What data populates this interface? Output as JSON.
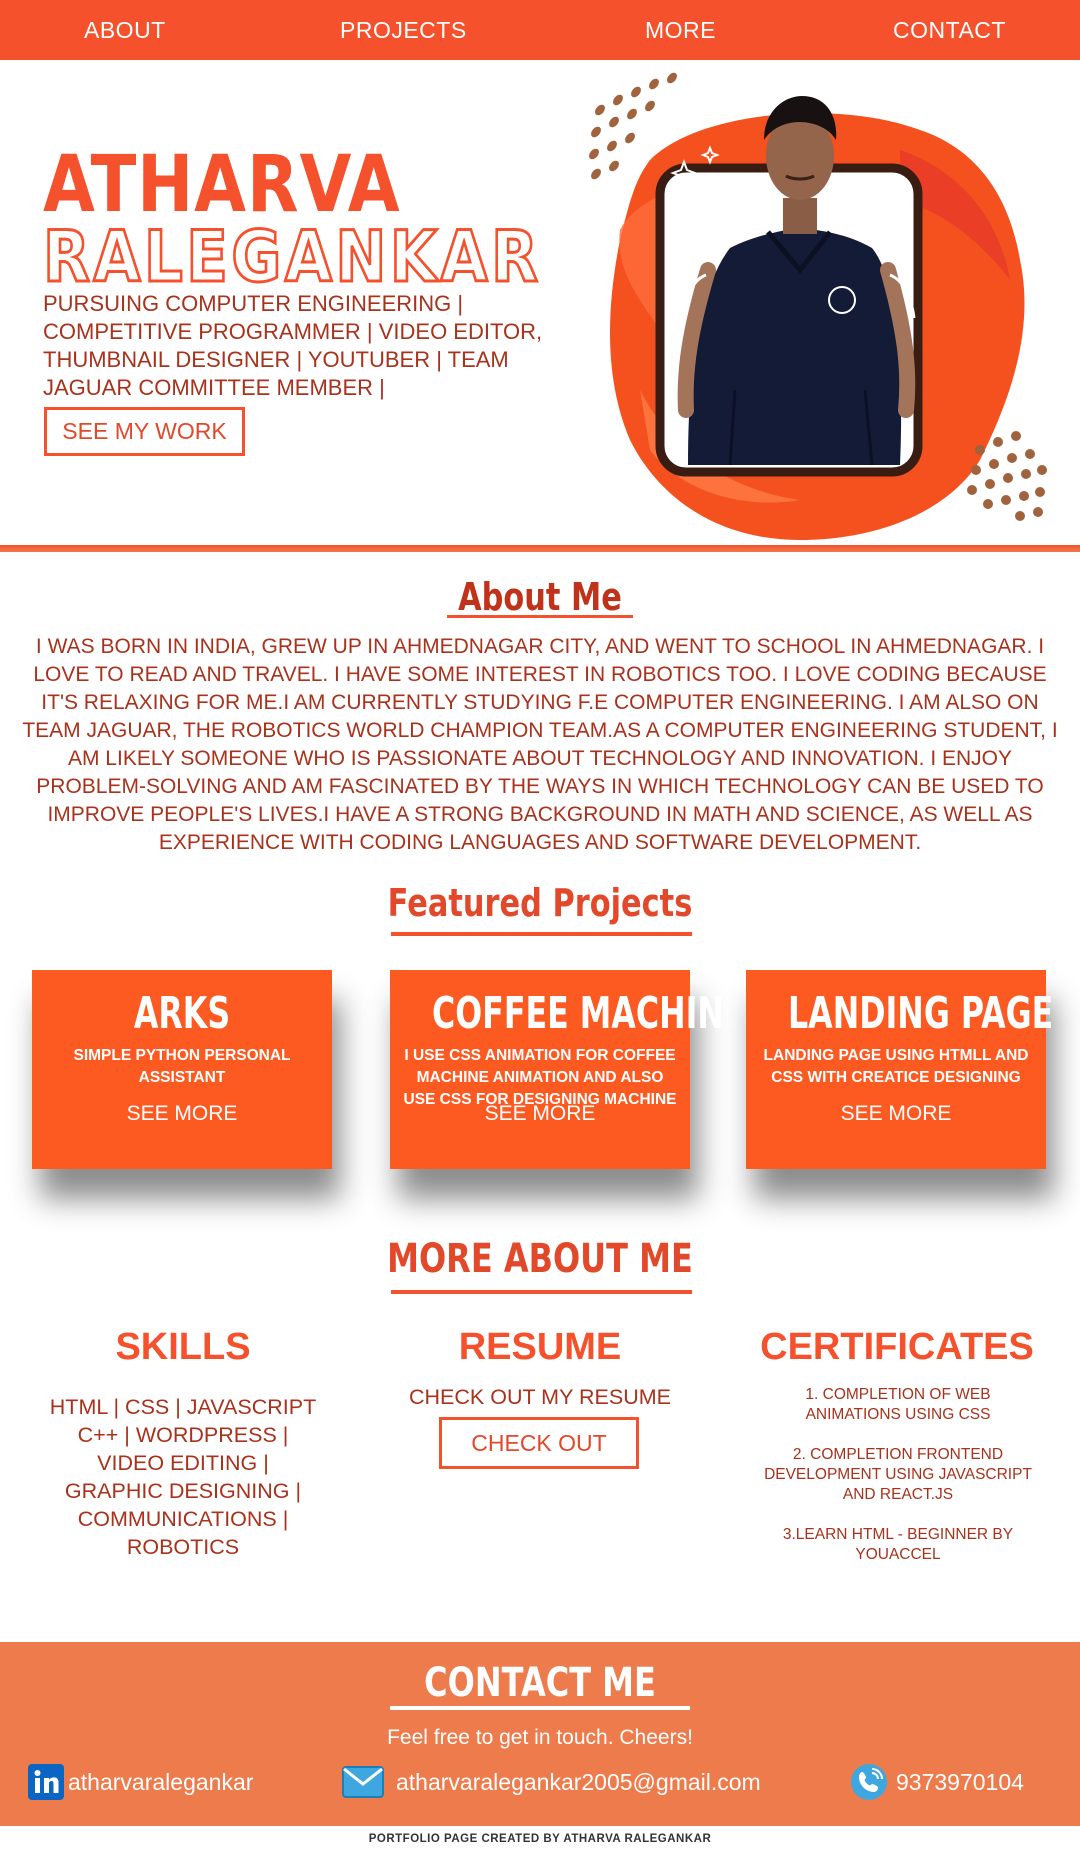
{
  "nav": {
    "about": "ABOUT",
    "projects": "PROJECTS",
    "more": "MORE",
    "contact": "CONTACT"
  },
  "hero": {
    "first_name": "ATHARVA",
    "last_name": "RALEGANKAR",
    "tagline": "PURSUING COMPUTER ENGINEERING | COMPETITIVE PROGRAMMER | VIDEO EDITOR, THUMBNAIL DESIGNER | YOUTUBER | TEAM JAGUAR COMMITTEE MEMBER |",
    "cta": "SEE MY WORK"
  },
  "about": {
    "title": "About Me",
    "text": "I WAS BORN IN INDIA, GREW UP IN AHMEDNAGAR CITY, AND WENT TO SCHOOL IN AHMEDNAGAR. I LOVE TO READ AND TRAVEL. I HAVE SOME INTEREST IN ROBOTICS TOO. I LOVE CODING BECAUSE IT'S RELAXING FOR ME.I AM CURRENTLY STUDYING F.E COMPUTER ENGINEERING. I AM ALSO ON TEAM JAGUAR, THE ROBOTICS WORLD CHAMPION TEAM.AS A COMPUTER ENGINEERING STUDENT, I AM LIKELY SOMEONE WHO IS PASSIONATE ABOUT TECHNOLOGY AND INNOVATION. I ENJOY PROBLEM-SOLVING AND AM FASCINATED BY THE WAYS IN WHICH TECHNOLOGY CAN BE USED TO IMPROVE PEOPLE'S LIVES.I HAVE A STRONG BACKGROUND IN MATH AND SCIENCE, AS WELL AS EXPERIENCE WITH CODING LANGUAGES AND SOFTWARE DEVELOPMENT."
  },
  "featured": {
    "title": "Featured Projects",
    "projects": [
      {
        "title": "ARKS",
        "desc": "SIMPLE PYTHON PERSONAL ASSISTANT",
        "more": "SEE MORE"
      },
      {
        "title": "COFFEE MACHINE",
        "desc": "I USE CSS ANIMATION FOR COFFEE MACHINE ANIMATION AND ALSO USE CSS FOR DESIGNING MACHINE",
        "more": "SEE MORE"
      },
      {
        "title": "LANDING PAGE",
        "desc": "LANDING PAGE USING HTMLL AND CSS WITH CREATICE DESIGNING",
        "more": "SEE MORE"
      }
    ]
  },
  "more_about": {
    "title": "MORE ABOUT ME",
    "skills": {
      "title": "SKILLS",
      "lines": [
        "HTML | CSS | JAVASCRIPT",
        "C++ | WORDPRESS |",
        "VIDEO EDITING |",
        "GRAPHIC DESIGNING |",
        "COMMUNICATIONS |",
        "ROBOTICS"
      ]
    },
    "resume": {
      "title": "RESUME",
      "text": "CHECK OUT MY RESUME",
      "button": "CHECK OUT"
    },
    "certificates": {
      "title": "CERTIFICATES",
      "items": [
        "1. COMPLETION OF WEB ANIMATIONS USING CSS",
        "2. COMPLETION FRONTEND DEVELOPMENT USING JAVASCRIPT AND REACT.JS",
        "3.LEARN HTML - BEGINNER BY YOUACCEL"
      ]
    }
  },
  "contact": {
    "title": "CONTACT ME",
    "subtitle": "Feel free to get in touch. Cheers!",
    "linkedin": "atharvaralegankar",
    "email": "atharvaralegankar2005@gmail.com",
    "phone": "9373970104"
  },
  "footer": {
    "credit": "PORTFOLIO PAGE CREATED BY ATHARVA RALEGANKAR"
  },
  "icons": {
    "linkedin": "linkedin-icon",
    "email": "mail-icon",
    "phone": "phone-icon"
  },
  "colors": {
    "accent": "#f4512c",
    "card": "#fd5a22",
    "contact_bg": "#ee7b4c",
    "text": "#a8321c"
  }
}
